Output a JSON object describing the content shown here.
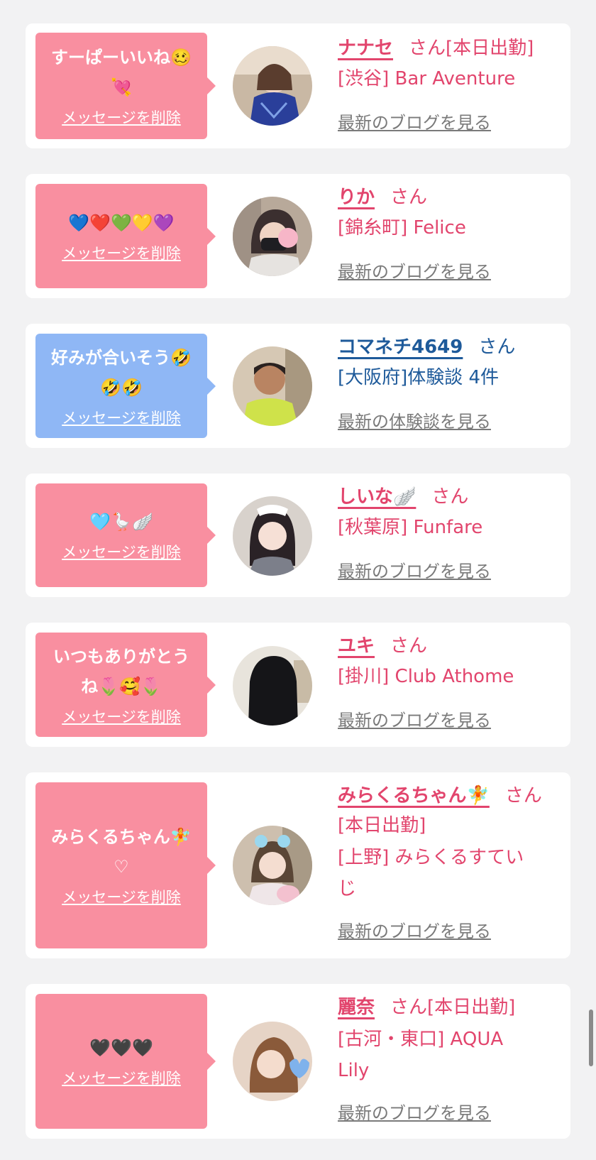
{
  "delete_label": "メッセージを削除",
  "san": "さん",
  "cards": [
    {
      "message": "すーぱーいいね🥴\n💘",
      "bubble_color": "#f98fa0",
      "name": "ナナセ",
      "status": "[本日出勤]",
      "shop": "[渋谷] Bar Aventure",
      "blog": "最新のブログを見る"
    },
    {
      "message": "💙❤️💚💛💜",
      "bubble_color": "#f98fa0",
      "name": "りか",
      "status": "",
      "shop": "[錦糸町] Felice",
      "blog": "最新のブログを見る"
    },
    {
      "message": "好みが合いそう🤣\n🤣🤣",
      "bubble_color": "#8fb7f5",
      "name": "コマネチ4649",
      "status": "",
      "shop": "[大阪府]体験談 4件",
      "blog": "最新の体験談を見る"
    },
    {
      "message": "🩵🪿🪽",
      "bubble_color": "#f98fa0",
      "name": "しいな🪽",
      "status": "",
      "shop": "[秋葉原] Funfare",
      "blog": "最新のブログを見る"
    },
    {
      "message": "いつもありがとう\nね🌷🥰🌷",
      "bubble_color": "#f98fa0",
      "name": "ユキ",
      "status": "",
      "shop": "[掛川] Club Athome",
      "blog": "最新のブログを見る"
    },
    {
      "message": "みらくるちゃん🧚\n♡",
      "bubble_color": "#f98fa0",
      "name": "みらくるちゃん🧚",
      "status": "[本日出勤]",
      "shop": "[上野] みらくるすていじ",
      "blog": "最新のブログを見る"
    },
    {
      "message": "🖤🖤🖤",
      "bubble_color": "#f98fa0",
      "name": "麗奈",
      "status": "[本日出勤]",
      "shop": "[古河・東口] AQUA Lily",
      "blog": "最新のブログを見る"
    }
  ]
}
